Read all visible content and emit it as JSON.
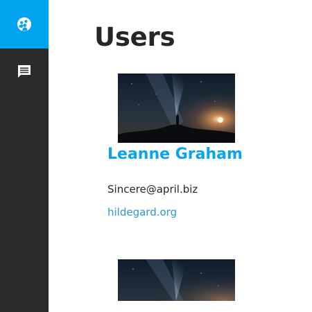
{
  "sidebar": {
    "items": [
      {
        "icon": "users-icon",
        "active": true
      },
      {
        "icon": "comment-icon",
        "active": false
      }
    ],
    "active_color": "#00a3ee",
    "background": "#2a2c2b"
  },
  "page": {
    "title": "Users"
  },
  "users": [
    {
      "name": "Leanne Graham",
      "email": "Sincere@april.biz",
      "website": "hildegard.org"
    }
  ],
  "colors": {
    "accent": "#08a4ee",
    "link": "#2a97d8",
    "text": "#262626"
  }
}
